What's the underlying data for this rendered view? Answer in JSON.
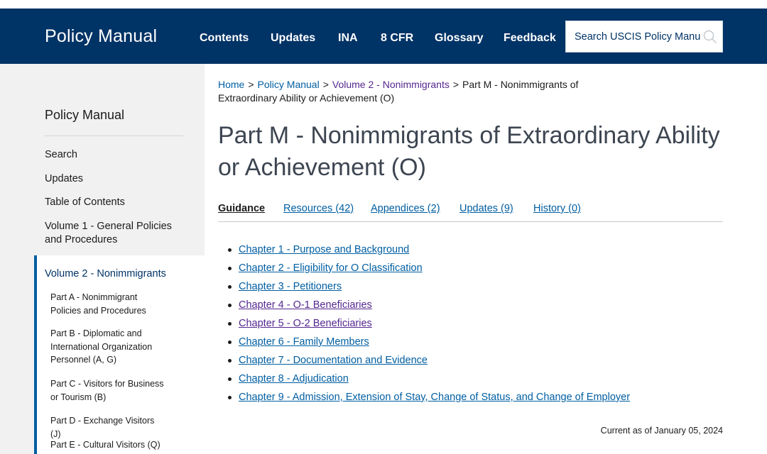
{
  "header": {
    "brand": "Policy Manual",
    "nav": [
      {
        "label": "Contents"
      },
      {
        "label": "Updates"
      },
      {
        "label": "INA"
      },
      {
        "label": "8 CFR"
      },
      {
        "label": "Glossary"
      },
      {
        "label": "Feedback"
      }
    ],
    "search_placeholder": "Search USCIS Policy Manual",
    "search_icon": "search-icon"
  },
  "sidebar": {
    "title": "Policy Manual",
    "links": [
      {
        "label": "Search"
      },
      {
        "label": "Updates"
      },
      {
        "label": "Table of Contents"
      },
      {
        "label": "Volume 1 - General Policies and Procedures"
      }
    ],
    "volume2": {
      "label": "Volume 2 - Nonimmigrants",
      "parts": [
        {
          "label": "Part A - Nonimmigrant Policies and Procedures"
        },
        {
          "label": "Part B - Diplomatic and International Organization Personnel (A, G)"
        },
        {
          "label": "Part C - Visitors for Business or Tourism (B)"
        },
        {
          "label": "Part D - Exchange Visitors (J)"
        },
        {
          "label": "Part E - Cultural Visitors (Q)"
        }
      ]
    }
  },
  "breadcrumb": {
    "items": [
      "Home",
      "Policy Manual",
      "Volume 2 - Nonimmigrants"
    ],
    "current": "Part M - Nonimmigrants of Extraordinary Ability or Achievement (O)"
  },
  "page_title": "Part M - Nonimmigrants of Extraordinary Ability or Achievement (O)",
  "tabs": [
    {
      "label": "Guidance",
      "active": true
    },
    {
      "label": "Resources (42)"
    },
    {
      "label": "Appendices (2)"
    },
    {
      "label": "Updates (9)"
    },
    {
      "label": "History (0)"
    }
  ],
  "chapters": [
    {
      "label": "Chapter 1 - Purpose and Background"
    },
    {
      "label": "Chapter 2 - Eligibility for O Classification"
    },
    {
      "label": "Chapter 3 - Petitioners"
    },
    {
      "label": "Chapter 4 - O-1 Beneficiaries"
    },
    {
      "label": "Chapter 5 - O-2 Beneficiaries"
    },
    {
      "label": "Chapter 6 - Family Members"
    },
    {
      "label": "Chapter 7 - Documentation and Evidence"
    },
    {
      "label": "Chapter 8 - Adjudication"
    },
    {
      "label": "Chapter 9 - Admission, Extension of Stay, Change of Status, and Change of Employer"
    }
  ],
  "current_as_of": "Current as of January 05, 2024",
  "colors": {
    "header_bg": "#003366",
    "link": "#005ea2",
    "visited_link": "#54278f",
    "sidebar_bg": "#f1f1f1",
    "sidebar_accent": "#005ea2"
  }
}
